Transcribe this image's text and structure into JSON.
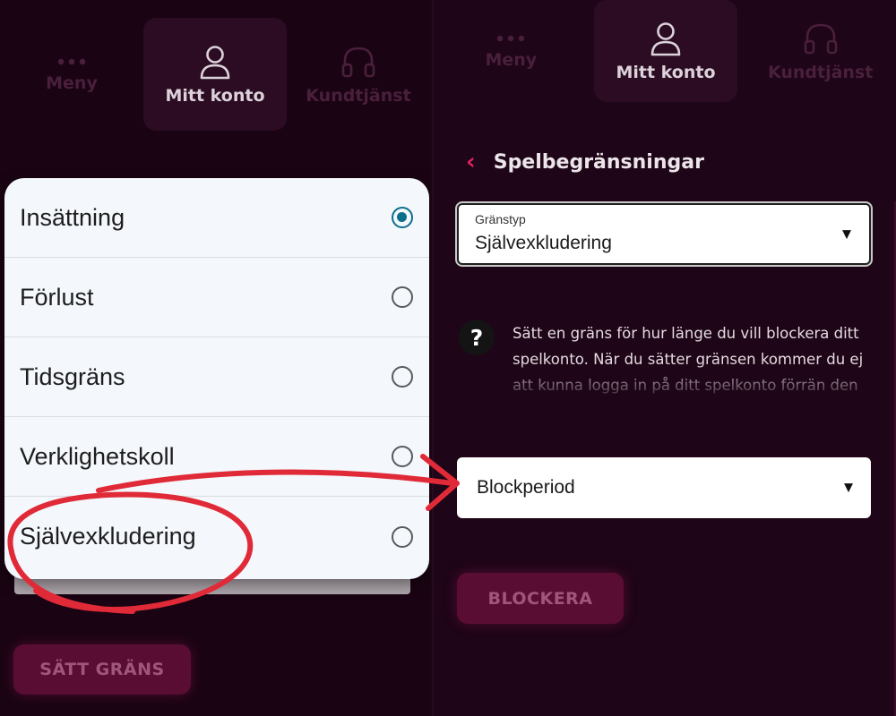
{
  "nav": {
    "items": [
      {
        "label": "Meny",
        "icon": "dots-icon"
      },
      {
        "label": "Mitt konto",
        "icon": "user-icon"
      },
      {
        "label": "Kundtjänst",
        "icon": "headset-icon"
      }
    ]
  },
  "left": {
    "options": [
      {
        "label": "Insättning",
        "selected": true
      },
      {
        "label": "Förlust",
        "selected": false
      },
      {
        "label": "Tidsgräns",
        "selected": false
      },
      {
        "label": "Verklighetskoll",
        "selected": false
      },
      {
        "label": "Självexkludering",
        "selected": false
      }
    ],
    "button_label": "SÄTT GRÄNS"
  },
  "right": {
    "title": "Spelbegränsningar",
    "type_select": {
      "label": "Gränstyp",
      "value": "Självexkludering"
    },
    "help_text": "Sätt en gräns för hur länge du vill blockera ditt spelkonto. När du sätter gränsen kommer du ej att kunna logga in på ditt spelkonto förrän den",
    "period_select": {
      "value": "Blockperiod"
    },
    "button_label": "BLOCKERA"
  },
  "colors": {
    "accent": "#e0245e",
    "background": "#1a0413",
    "radio_selected": "#0a6f8a",
    "annotation": "#e02a38"
  }
}
